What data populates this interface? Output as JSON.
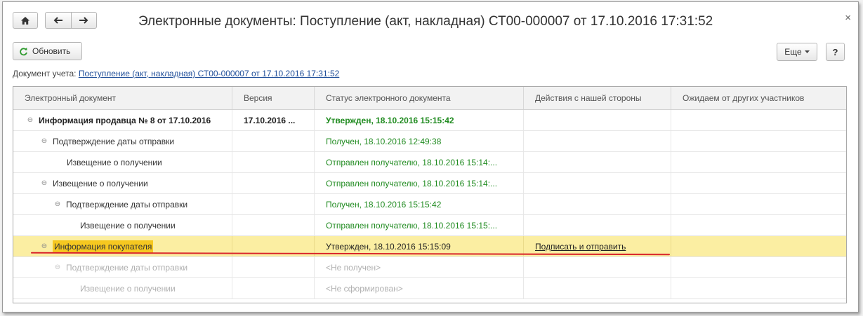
{
  "window": {
    "title": "Электронные документы: Поступление (акт, накладная) СТ00-000007 от 17.10.2016 17:31:52",
    "close_glyph": "×"
  },
  "nav": {
    "home_icon": "home-icon",
    "back_icon": "arrow-left-icon",
    "forward_icon": "arrow-right-icon"
  },
  "toolbar": {
    "refresh_label": "Обновить",
    "more_label": "Еще",
    "help_label": "?"
  },
  "document": {
    "label": "Документ учета:",
    "link_text": "Поступление (акт, накладная) СТ00-000007 от 17.10.2016 17:31:52"
  },
  "grid": {
    "columns": [
      "Электронный документ",
      "Версия",
      "Статус электронного документа",
      "Действия с нашей стороны",
      "Ожидаем от других участников"
    ],
    "rows": [
      {
        "name": "Информация продавца № 8 от 17.10.2016",
        "version": "17.10.2016 ...",
        "status": "Утвержден, 18.10.2016 15:15:42",
        "action": "",
        "waiting": ""
      },
      {
        "name": "Подтверждение даты отправки",
        "version": "",
        "status": "Получен, 18.10.2016 12:49:38",
        "action": "",
        "waiting": ""
      },
      {
        "name": "Извещение о получении",
        "version": "",
        "status": "Отправлен получателю, 18.10.2016 15:14:...",
        "action": "",
        "waiting": ""
      },
      {
        "name": "Извещение о получении",
        "version": "",
        "status": "Отправлен получателю, 18.10.2016 15:14:...",
        "action": "",
        "waiting": ""
      },
      {
        "name": "Подтверждение даты отправки",
        "version": "",
        "status": "Получен, 18.10.2016 15:15:42",
        "action": "",
        "waiting": ""
      },
      {
        "name": "Извещение о получении",
        "version": "",
        "status": "Отправлен получателю, 18.10.2016 15:15:...",
        "action": "",
        "waiting": ""
      },
      {
        "name": "Информация покупателя",
        "version": "",
        "status": "Утвержден, 18.10.2016 15:15:09",
        "action": "Подписать и отправить",
        "waiting": ""
      },
      {
        "name": "Подтверждение даты отправки",
        "version": "",
        "status": "<Не получен>",
        "action": "",
        "waiting": ""
      },
      {
        "name": "Извещение о получении",
        "version": "",
        "status": "<Не сформирован>",
        "action": "",
        "waiting": ""
      }
    ]
  },
  "colors": {
    "status_green": "#208b20",
    "selected_row": "#fbeea2",
    "highlight": "#f6c820",
    "annotation_red": "#d9262c",
    "link_blue": "#1f4e99"
  }
}
